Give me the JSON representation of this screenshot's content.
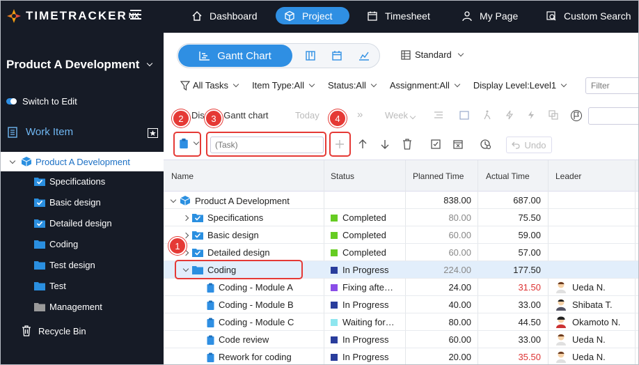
{
  "brand": {
    "name": "TIMETRACKER",
    "suffix": "NX"
  },
  "nav": [
    {
      "label": "Dashboard",
      "icon": "home-icon",
      "active": false
    },
    {
      "label": "Project",
      "icon": "cube-icon",
      "active": true
    },
    {
      "label": "Timesheet",
      "icon": "calendar-icon",
      "active": false
    },
    {
      "label": "My Page",
      "icon": "person-icon",
      "active": false
    },
    {
      "label": "Custom Search",
      "icon": "search-list-icon",
      "active": false
    }
  ],
  "sidebar": {
    "project_title": "Product A Development",
    "switch_label": "Switch to Edit",
    "work_item_label": "Work Item",
    "tree_root": "Product A Development",
    "items": [
      {
        "label": "Specifications",
        "icon": "checked-folder-icon"
      },
      {
        "label": "Basic design",
        "icon": "checked-folder-icon"
      },
      {
        "label": "Detailed design",
        "icon": "checked-folder-icon"
      },
      {
        "label": "Coding",
        "icon": "folder-icon"
      },
      {
        "label": "Test design",
        "icon": "folder-icon"
      },
      {
        "label": "Test",
        "icon": "folder-icon"
      },
      {
        "label": "Management",
        "icon": "gray-folder-icon"
      }
    ],
    "recycle_bin": "Recycle Bin"
  },
  "view": {
    "gantt_label": "Gantt Chart",
    "standard_label": "Standard"
  },
  "filters": {
    "all_tasks": "All Tasks",
    "item_type": "Item Type:All",
    "status": "Status:All",
    "assignment": "Assignment:All",
    "display_level": "Display Level:Level1",
    "filter_placeholder": "Filter"
  },
  "gantt_toolbar": {
    "display_label": "Display Gantt chart",
    "today": "Today",
    "week": "Week"
  },
  "toolbar": {
    "task_placeholder": "(Task)",
    "undo_label": "Undo"
  },
  "callouts": [
    "1",
    "2",
    "3",
    "4"
  ],
  "table": {
    "columns": [
      "Name",
      "Status",
      "Planned Time",
      "Actual Time",
      "Leader"
    ],
    "rows": [
      {
        "name": "Product A Development",
        "status": "",
        "status_color": "",
        "planned": "838.00",
        "actual": "687.00",
        "leader": ""
      },
      {
        "name": "Specifications",
        "status": "Completed",
        "status_color": "#66cc22",
        "planned": "80.00",
        "actual": "75.50",
        "leader": ""
      },
      {
        "name": "Basic design",
        "status": "Completed",
        "status_color": "#66cc22",
        "planned": "60.00",
        "actual": "59.00",
        "leader": ""
      },
      {
        "name": "Detailed design",
        "status": "Completed",
        "status_color": "#66cc22",
        "planned": "60.00",
        "actual": "57.00",
        "leader": ""
      },
      {
        "name": "Coding",
        "status": "In Progress",
        "status_color": "#2a3d9c",
        "planned": "224.00",
        "actual": "177.50",
        "leader": ""
      },
      {
        "name": "Coding - Module A",
        "status": "Fixing afte…",
        "status_color": "#8a4de8",
        "planned": "24.00",
        "actual": "31.50",
        "leader": "Ueda N."
      },
      {
        "name": "Coding - Module B",
        "status": "In Progress",
        "status_color": "#2a3d9c",
        "planned": "40.00",
        "actual": "33.00",
        "leader": "Shibata T."
      },
      {
        "name": "Coding - Module C",
        "status": "Waiting for…",
        "status_color": "#8ee6ef",
        "planned": "80.00",
        "actual": "44.50",
        "leader": "Okamoto N."
      },
      {
        "name": "Code review",
        "status": "In Progress",
        "status_color": "#2a3d9c",
        "planned": "60.00",
        "actual": "33.00",
        "leader": "Ueda N."
      },
      {
        "name": "Rework for coding",
        "status": "In Progress",
        "status_color": "#2a3d9c",
        "planned": "20.00",
        "actual": "35.50",
        "leader": "Ueda N."
      }
    ]
  }
}
